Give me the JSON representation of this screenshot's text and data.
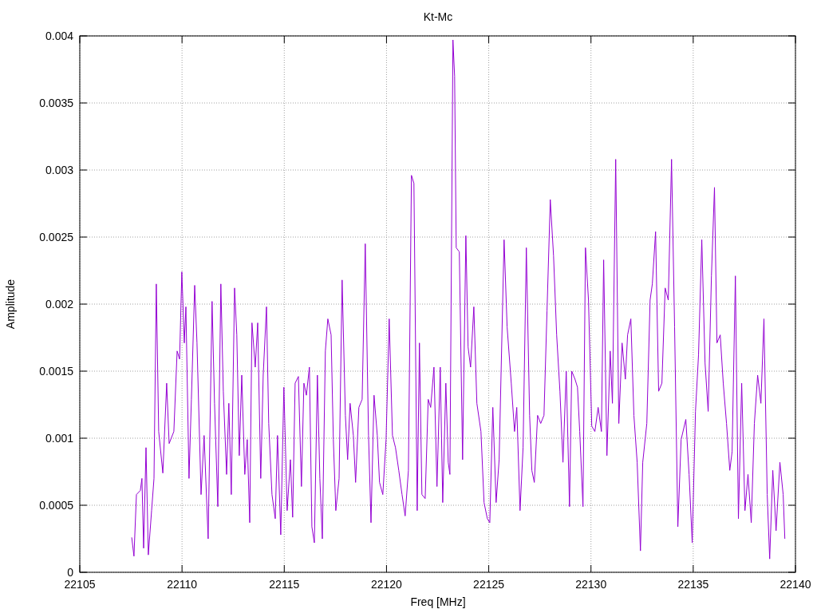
{
  "chart_data": {
    "type": "line",
    "grid": true,
    "title": "Kt-Mc",
    "xlabel": "Freq [MHz]",
    "ylabel": "Amplitude",
    "xlim": [
      22105,
      22140
    ],
    "ylim": [
      0,
      0.004
    ],
    "xticks": [
      22105,
      22110,
      22115,
      22120,
      22125,
      22130,
      22135,
      22140
    ],
    "yticks": [
      {
        "value": 0,
        "label": "0"
      },
      {
        "value": 0.0005,
        "label": "0.0005"
      },
      {
        "value": 0.001,
        "label": "0.001"
      },
      {
        "value": 0.0015,
        "label": "0.0015"
      },
      {
        "value": 0.002,
        "label": "0.002"
      },
      {
        "value": 0.0025,
        "label": "0.0025"
      },
      {
        "value": 0.003,
        "label": "0.003"
      },
      {
        "value": 0.0035,
        "label": "0.0035"
      },
      {
        "value": 0.004,
        "label": "0.004"
      }
    ],
    "x": [
      22107.54,
      22107.65,
      22107.77,
      22107.96,
      22108.04,
      22108.12,
      22108.24,
      22108.35,
      22108.51,
      22108.63,
      22108.74,
      22108.86,
      22109.06,
      22109.25,
      22109.37,
      22109.6,
      22109.76,
      22109.88,
      22109.99,
      22110.11,
      22110.19,
      22110.34,
      22110.46,
      22110.62,
      22110.73,
      22110.93,
      22111.08,
      22111.28,
      22111.47,
      22111.59,
      22111.75,
      22111.9,
      22112.02,
      22112.18,
      22112.29,
      22112.41,
      22112.57,
      22112.68,
      22112.8,
      22112.92,
      22113.07,
      22113.19,
      22113.31,
      22113.42,
      22113.58,
      22113.7,
      22113.85,
      22113.97,
      22114.13,
      22114.24,
      22114.4,
      22114.56,
      22114.67,
      22114.83,
      22114.98,
      22115.14,
      22115.3,
      22115.41,
      22115.53,
      22115.69,
      22115.84,
      22115.96,
      22116.08,
      22116.23,
      22116.35,
      22116.47,
      22116.62,
      22116.74,
      22116.86,
      22117.01,
      22117.13,
      22117.29,
      22117.4,
      22117.52,
      22117.68,
      22117.83,
      22117.99,
      22118.1,
      22118.22,
      22118.38,
      22118.49,
      22118.65,
      22118.81,
      22118.96,
      22119.12,
      22119.24,
      22119.39,
      22119.55,
      22119.66,
      22119.82,
      22119.98,
      22120.13,
      22120.29,
      22120.44,
      22120.6,
      22120.76,
      22120.91,
      22121.07,
      22121.22,
      22121.34,
      22121.5,
      22121.61,
      22121.73,
      22121.89,
      22122.04,
      22122.16,
      22122.32,
      22122.47,
      22122.63,
      22122.75,
      22122.9,
      22123.02,
      22123.1,
      22123.25,
      22123.33,
      22123.41,
      22123.56,
      22123.72,
      22123.88,
      22123.99,
      22124.11,
      22124.27,
      22124.42,
      22124.62,
      22124.77,
      22124.93,
      22125.05,
      22125.2,
      22125.36,
      22125.51,
      22125.75,
      22125.9,
      22126.1,
      22126.26,
      22126.37,
      22126.53,
      22126.68,
      22126.84,
      22127.0,
      22127.11,
      22127.23,
      22127.39,
      22127.54,
      22127.7,
      22127.85,
      22128.01,
      22128.17,
      22128.32,
      22128.48,
      22128.63,
      22128.79,
      22128.95,
      22129.06,
      22129.22,
      22129.34,
      22129.45,
      22129.61,
      22129.73,
      22129.88,
      22130.04,
      22130.19,
      22130.35,
      22130.51,
      22130.62,
      22130.78,
      22130.94,
      22131.05,
      22131.21,
      22131.36,
      22131.52,
      22131.68,
      22131.79,
      22131.95,
      22132.1,
      22132.26,
      22132.42,
      22132.53,
      22132.73,
      22132.89,
      22133.0,
      22133.16,
      22133.31,
      22133.47,
      22133.63,
      22133.78,
      22133.94,
      22134.09,
      22134.25,
      22134.41,
      22134.64,
      22134.8,
      22134.95,
      22135.11,
      22135.26,
      22135.42,
      22135.58,
      22135.73,
      22135.89,
      22136.04,
      22136.16,
      22136.32,
      22136.47,
      22136.63,
      22136.79,
      22136.9,
      22137.06,
      22137.21,
      22137.37,
      22137.53,
      22137.68,
      22137.84,
      22137.99,
      22138.15,
      22138.31,
      22138.46,
      22138.62,
      22138.74,
      22138.89,
      22139.05,
      22139.24,
      22139.4,
      22139.48
    ],
    "series": [
      {
        "color": "#9400d3",
        "values": [
          0.00026,
          0.00012,
          0.00058,
          0.00061,
          0.0007,
          0.00018,
          0.00093,
          0.00013,
          0.00046,
          0.0007,
          0.00215,
          0.00105,
          0.00074,
          0.00141,
          0.00096,
          0.00105,
          0.00165,
          0.00159,
          0.00224,
          0.00171,
          0.00198,
          0.0007,
          0.00129,
          0.00214,
          0.00171,
          0.00058,
          0.00102,
          0.00025,
          0.00202,
          0.00126,
          0.00049,
          0.00215,
          0.00135,
          0.00073,
          0.00126,
          0.00058,
          0.00212,
          0.00177,
          0.00087,
          0.00147,
          0.00073,
          0.00099,
          0.00037,
          0.00186,
          0.00153,
          0.00186,
          0.0007,
          0.00147,
          0.00198,
          0.00111,
          0.00058,
          0.0004,
          0.00102,
          0.00028,
          0.00138,
          0.00046,
          0.00084,
          0.00041,
          0.00141,
          0.00146,
          0.00064,
          0.00141,
          0.00132,
          0.00153,
          0.00034,
          0.00022,
          0.00147,
          0.0007,
          0.00025,
          0.00165,
          0.00189,
          0.00177,
          0.00099,
          0.00046,
          0.0007,
          0.00218,
          0.00117,
          0.00084,
          0.00126,
          0.00102,
          0.00067,
          0.00123,
          0.00129,
          0.00245,
          0.00102,
          0.00037,
          0.00132,
          0.00102,
          0.00067,
          0.00058,
          0.00099,
          0.00189,
          0.00102,
          0.00093,
          0.00076,
          0.00058,
          0.00042,
          0.00076,
          0.00296,
          0.0029,
          0.00046,
          0.00171,
          0.00058,
          0.00055,
          0.00129,
          0.00123,
          0.00153,
          0.00064,
          0.00153,
          0.00052,
          0.00141,
          0.00082,
          0.00073,
          0.00397,
          0.0037,
          0.00242,
          0.00239,
          0.00084,
          0.00251,
          0.00168,
          0.00153,
          0.00198,
          0.00126,
          0.00105,
          0.00052,
          0.0004,
          0.00037,
          0.00123,
          0.00052,
          0.00084,
          0.00248,
          0.00183,
          0.00141,
          0.00105,
          0.00123,
          0.00046,
          0.00093,
          0.00242,
          0.00117,
          0.00076,
          0.00067,
          0.00117,
          0.00111,
          0.00117,
          0.00195,
          0.00278,
          0.00236,
          0.00177,
          0.00135,
          0.00082,
          0.0015,
          0.00049,
          0.0015,
          0.00144,
          0.00138,
          0.00105,
          0.00049,
          0.00242,
          0.00203,
          0.00109,
          0.00105,
          0.00123,
          0.00105,
          0.00233,
          0.00087,
          0.00165,
          0.00126,
          0.00308,
          0.00111,
          0.00171,
          0.00144,
          0.00177,
          0.00189,
          0.00117,
          0.00082,
          0.00016,
          0.00082,
          0.00111,
          0.00203,
          0.00215,
          0.00254,
          0.00135,
          0.00141,
          0.00212,
          0.00203,
          0.00308,
          0.00183,
          0.00034,
          0.00099,
          0.00114,
          0.00073,
          0.00022,
          0.0012,
          0.00162,
          0.00248,
          0.00156,
          0.0012,
          0.00221,
          0.00287,
          0.00171,
          0.00177,
          0.00141,
          0.00111,
          0.00076,
          0.0009,
          0.00221,
          0.0004,
          0.00141,
          0.00046,
          0.00073,
          0.00037,
          0.00111,
          0.00147,
          0.00126,
          0.00189,
          0.00058,
          0.0001,
          0.00076,
          0.00031,
          0.00082,
          0.00058,
          0.00025
        ]
      }
    ]
  }
}
